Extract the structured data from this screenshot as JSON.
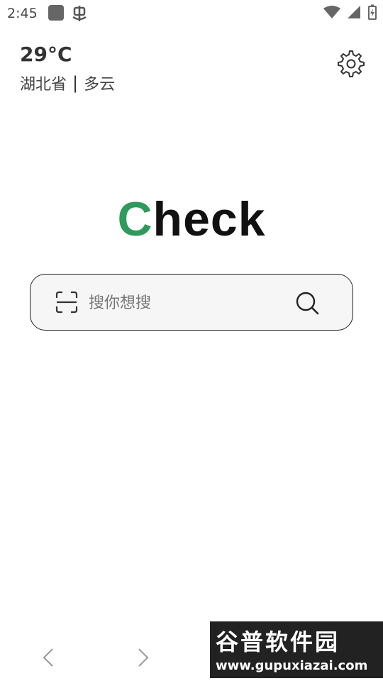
{
  "status_bar": {
    "time": "2:45"
  },
  "weather": {
    "temperature": "29°C",
    "region": "湖北省",
    "separator": "|",
    "condition": "多云"
  },
  "logo": {
    "first_letter": "C",
    "rest": "heck",
    "accent_color": "#2e9a5c"
  },
  "search": {
    "placeholder": "搜你想搜"
  },
  "icons": {
    "settings": "gear-icon",
    "scan": "scan-icon",
    "search": "search-icon",
    "back": "chevron-left-icon",
    "forward": "chevron-right-icon"
  },
  "watermark": {
    "title": "谷普软件园",
    "url": "www.gupuxiazai.com"
  }
}
